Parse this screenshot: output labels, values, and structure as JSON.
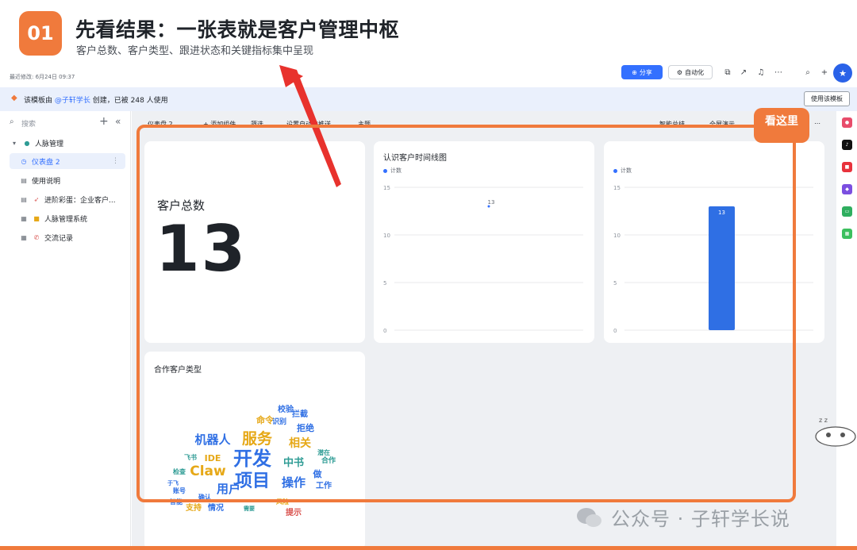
{
  "banner": {
    "badge": "01",
    "title": "先看结果：一张表就是客户管理中枢",
    "subtitle": "客户总数、客户类型、跟进状态和关键指标集中呈现"
  },
  "app_bar": {
    "modified": "最近修改: 6月24日 09:37",
    "share_label": "分享",
    "automation_label": "自动化"
  },
  "notice": {
    "prefix": "该模板由 ",
    "author": "@子轩学长",
    "suffix": " 创建，已被 248 人使用",
    "use_template_label": "使用该模板"
  },
  "sidebar": {
    "search_placeholder": "搜索",
    "root_label": "人脉管理",
    "items": [
      {
        "label": "仪表盘 2",
        "icon": "dashboard-icon",
        "active": true
      },
      {
        "label": "使用说明",
        "icon": "doc-icon",
        "active": false
      },
      {
        "label": "进阶彩蛋：企业客户...",
        "icon": "doc-icon",
        "active": false
      },
      {
        "label": "人脉管理系统",
        "icon": "table-icon",
        "active": false
      },
      {
        "label": "交流记录",
        "icon": "table-icon",
        "active": false
      }
    ]
  },
  "toolbar": {
    "items": [
      "仪表盘 2",
      "+ 添加组件",
      "筛选",
      "设置自动化推送",
      "主题"
    ],
    "right_items": [
      "智能总结",
      "全屏演示"
    ]
  },
  "kpi": {
    "label": "客户总数",
    "value": "13"
  },
  "chart_data": [
    {
      "type": "line",
      "title": "认识客户时间线图",
      "legend": "计数",
      "ylim": [
        0,
        15
      ],
      "yticks": [
        "15",
        "10",
        "5",
        "0"
      ],
      "points": [
        {
          "x": "",
          "y": 13
        }
      ],
      "value_labels": [
        "13"
      ]
    },
    {
      "type": "bar",
      "title": "",
      "legend": "计数",
      "ylim": [
        0,
        15
      ],
      "yticks": [
        "15",
        "10",
        "5",
        "0"
      ],
      "values": [
        13
      ],
      "value_labels": [
        "13"
      ],
      "color": "#2f6fe4"
    }
  ],
  "wordcloud": {
    "title": "合作客户类型",
    "words": [
      {
        "text": "开发",
        "size": 24,
        "color": "#2f6fe4"
      },
      {
        "text": "项目",
        "size": 22,
        "color": "#2f6fe4"
      },
      {
        "text": "服务",
        "size": 19,
        "color": "#e6a817"
      },
      {
        "text": "Claw",
        "size": 17,
        "color": "#e6a817"
      },
      {
        "text": "机器人",
        "size": 15,
        "color": "#2f6fe4"
      },
      {
        "text": "用户",
        "size": 15,
        "color": "#2f6fe4"
      },
      {
        "text": "操作",
        "size": 15,
        "color": "#2f6fe4"
      },
      {
        "text": "相关",
        "size": 14,
        "color": "#e6a817"
      },
      {
        "text": "中书",
        "size": 13,
        "color": "#2f9c95"
      },
      {
        "text": "IDE",
        "size": 11,
        "color": "#e6a817"
      },
      {
        "text": "拒绝",
        "size": 11,
        "color": "#2f6fe4"
      },
      {
        "text": "命令",
        "size": 11,
        "color": "#e6a817"
      },
      {
        "text": "校验",
        "size": 10,
        "color": "#2f6fe4"
      },
      {
        "text": "拦截",
        "size": 10,
        "color": "#2f6fe4"
      },
      {
        "text": "识别",
        "size": 9,
        "color": "#2f6fe4"
      },
      {
        "text": "合作",
        "size": 9,
        "color": "#2f9c95"
      },
      {
        "text": "提示",
        "size": 10,
        "color": "#d9534f"
      },
      {
        "text": "情况",
        "size": 10,
        "color": "#2f6fe4"
      },
      {
        "text": "支持",
        "size": 10,
        "color": "#e6a817"
      },
      {
        "text": "工作",
        "size": 10,
        "color": "#2f6fe4"
      },
      {
        "text": "做",
        "size": 11,
        "color": "#2f6fe4"
      },
      {
        "text": "账号",
        "size": 8,
        "color": "#2f6fe4"
      },
      {
        "text": "检查",
        "size": 8,
        "color": "#2f9c95"
      },
      {
        "text": "确认",
        "size": 8,
        "color": "#2f6fe4"
      },
      {
        "text": "潜在",
        "size": 8,
        "color": "#2f9c95"
      },
      {
        "text": "风险",
        "size": 8,
        "color": "#e6a817"
      },
      {
        "text": "智能",
        "size": 8,
        "color": "#2f6fe4"
      },
      {
        "text": "飞书",
        "size": 8,
        "color": "#2f9c95"
      },
      {
        "text": "于飞",
        "size": 7,
        "color": "#2f6fe4"
      },
      {
        "text": "需要",
        "size": 7,
        "color": "#2f9c95"
      }
    ]
  },
  "overlay": {
    "callout": "看这里",
    "watermark": "公众号 · 子轩学长说"
  },
  "colors": {
    "accent": "#f07a3c",
    "brand_blue": "#3370ff",
    "bar_blue": "#2f6fe4"
  }
}
